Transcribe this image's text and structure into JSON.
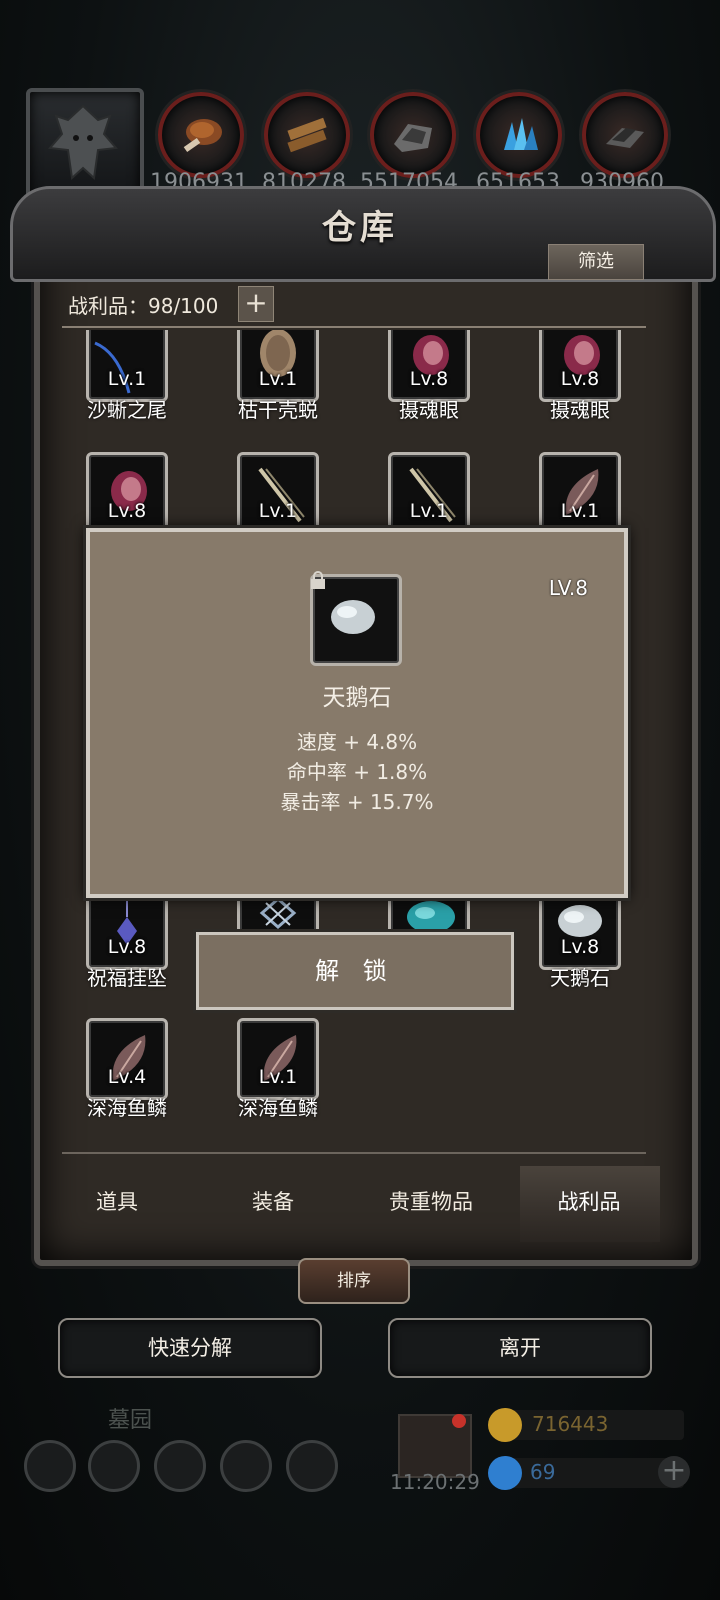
{
  "resources": [
    "1906931",
    "810278",
    "5517054",
    "651653",
    "930960"
  ],
  "warehouse": {
    "title": "仓库",
    "filter_label": "筛选",
    "count_label": "战利品：98/100",
    "plus_label": "+",
    "items": [
      {
        "lv": "Lv.1",
        "name": "沙蜥之尾",
        "icon": "tail-icon"
      },
      {
        "lv": "Lv.1",
        "name": "枯干壳蜕",
        "icon": "husk-icon"
      },
      {
        "lv": "Lv.8",
        "name": "摄魂眼",
        "icon": "soul-eye-icon"
      },
      {
        "lv": "Lv.8",
        "name": "摄魂眼",
        "icon": "soul-eye-icon"
      },
      {
        "lv": "Lv.8",
        "name": "",
        "icon": "soul-eye-icon"
      },
      {
        "lv": "Lv.1",
        "name": "",
        "icon": "bone-staff-icon"
      },
      {
        "lv": "Lv.1",
        "name": "",
        "icon": "bone-staff-icon"
      },
      {
        "lv": "Lv.1",
        "name": "",
        "icon": "scale-icon"
      },
      {
        "lv": "Lv.8",
        "name": "祝福挂坠",
        "icon": "pendant-icon"
      },
      {
        "lv": "",
        "name": "",
        "icon": "emblem-icon"
      },
      {
        "lv": "",
        "name": "",
        "icon": "teal-stone-icon"
      },
      {
        "lv": "Lv.8",
        "name": "天鹅石",
        "icon": "swan-stone-icon"
      },
      {
        "lv": "Lv.4",
        "name": "深海鱼鳞",
        "icon": "scale-icon"
      },
      {
        "lv": "Lv.1",
        "name": "深海鱼鳞",
        "icon": "scale-icon"
      }
    ],
    "tabs": [
      "道具",
      "装备",
      "贵重物品",
      "战利品"
    ],
    "active_tab": "战利品",
    "sort_label": "排序",
    "quick_decompose_label": "快速分解",
    "leave_label": "离开"
  },
  "popup": {
    "level": "LV.8",
    "name": "天鹅石",
    "stats": [
      "速度 + 4.8%",
      "命中率 + 1.8%",
      "暴击率 + 15.7%"
    ],
    "unlock_label": "解 锁"
  },
  "hud": {
    "location": "墓园",
    "time": "11:20:29",
    "gold": "716443",
    "gems": "69",
    "gold_color": "#c89a2a",
    "gem_color": "#2f7fd0"
  }
}
